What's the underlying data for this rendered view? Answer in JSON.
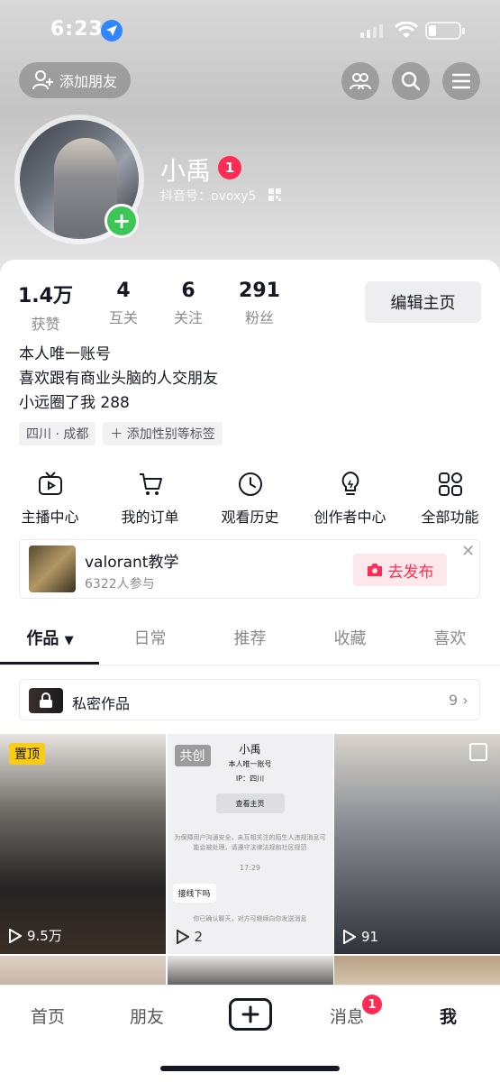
{
  "status_bar": {
    "time": "6:23"
  },
  "header": {
    "add_friend_label": "添加朋友",
    "name": "小禹",
    "name_badge": "1",
    "douyin_id": "抖音号：ovoxy5"
  },
  "stats": [
    {
      "value": "1.4万",
      "label": "获赞"
    },
    {
      "value": "4",
      "label": "互关"
    },
    {
      "value": "6",
      "label": "关注"
    },
    {
      "value": "291",
      "label": "粉丝"
    }
  ],
  "edit_profile_label": "编辑主页",
  "bio": [
    "本人唯一账号",
    "喜欢跟有商业头脑的人交朋友",
    "小远圈了我 288"
  ],
  "tags": [
    "四川 · 成都",
    "＋ 添加性别等标签"
  ],
  "quick_functions": [
    {
      "label": "主播中心",
      "icon": "tv-icon"
    },
    {
      "label": "我的订单",
      "icon": "cart-icon"
    },
    {
      "label": "观看历史",
      "icon": "clock-icon"
    },
    {
      "label": "创作者中心",
      "icon": "bulb-icon"
    },
    {
      "label": "全部功能",
      "icon": "grid-icon"
    }
  ],
  "promo": {
    "title": "valorant教学",
    "subtitle": "6322人参与",
    "button": "去发布"
  },
  "tabs": [
    "作品",
    "日常",
    "推荐",
    "收藏",
    "喜欢"
  ],
  "private_works": {
    "label": "私密作品",
    "count": "9"
  },
  "posts": [
    {
      "badge": "置顶",
      "views": "9.5万"
    },
    {
      "badge": "共创",
      "views": "2",
      "preview": {
        "title": "小禹",
        "bio": "本人唯一账号",
        "ip": "IP：四川",
        "button": "查看主页",
        "note": "为保障用户沟通安全，未互相关注的陌生人违规消息可能会被处理，请遵守法律法规和社区规范",
        "time": "17:29",
        "bubble": "接线下吗",
        "footer": "你已确认聊天，对方可继续向你发送消息"
      }
    },
    {
      "badge": "",
      "views": "91"
    }
  ],
  "bottom_nav": {
    "home": "首页",
    "friends": "朋友",
    "messages": "消息",
    "messages_badge": "1",
    "me": "我"
  },
  "colors": {
    "accent": "#fe2c55",
    "green": "#3bc656",
    "pin": "#facc15",
    "text": "#161823",
    "muted": "#8a8b91"
  }
}
